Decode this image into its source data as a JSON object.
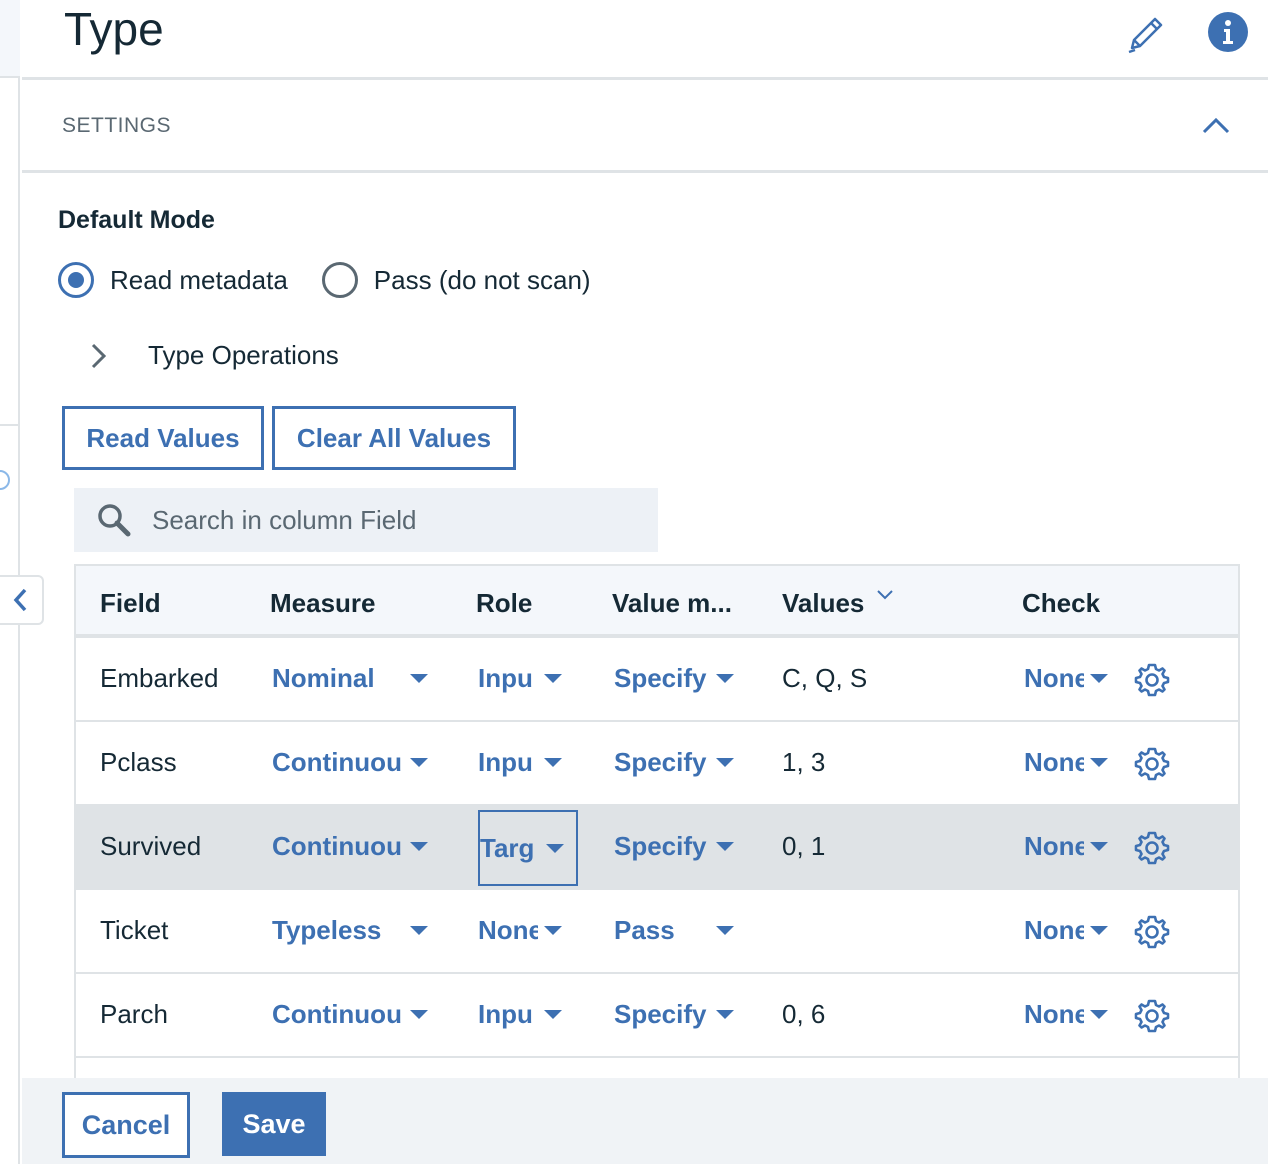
{
  "header": {
    "title": "Type"
  },
  "settings": {
    "label": "SETTINGS"
  },
  "default_mode": {
    "heading": "Default Mode",
    "options": [
      {
        "label": "Read metadata",
        "selected": true
      },
      {
        "label": "Pass (do not scan)",
        "selected": false
      }
    ]
  },
  "type_operations": {
    "label": "Type Operations"
  },
  "buttons": {
    "read_values": "Read Values",
    "clear_all_values": "Clear All Values"
  },
  "search": {
    "placeholder": "Search in column Field"
  },
  "table": {
    "columns": [
      "Field",
      "Measure",
      "Role",
      "Value m...",
      "Values",
      "Check"
    ],
    "rows": [
      {
        "field": "Embarked",
        "measure": "Nominal",
        "role": "Inpu",
        "value_mode": "Specify",
        "values": "C, Q, S",
        "check": "None",
        "selected": false
      },
      {
        "field": "Pclass",
        "measure": "Continuou",
        "role": "Inpu",
        "value_mode": "Specify",
        "values": "1, 3",
        "check": "None",
        "selected": false
      },
      {
        "field": "Survived",
        "measure": "Continuou",
        "role": "Targ",
        "value_mode": "Specify",
        "values": "0, 1",
        "check": "None",
        "selected": true
      },
      {
        "field": "Ticket",
        "measure": "Typeless",
        "role": "None",
        "value_mode": "Pass",
        "values": "",
        "check": "None",
        "selected": false
      },
      {
        "field": "Parch",
        "measure": "Continuou",
        "role": "Inpu",
        "value_mode": "Specify",
        "values": "0, 6",
        "check": "None",
        "selected": false
      }
    ]
  },
  "footer": {
    "cancel": "Cancel",
    "save": "Save"
  },
  "icons": {
    "edit": "pencil-icon",
    "info": "info-icon",
    "collapse": "chevron-up-icon",
    "expand": "chevron-right-icon",
    "search": "search-icon",
    "sort": "chevron-down-icon",
    "settings": "gear-icon",
    "side_toggle": "chevron-left-icon"
  },
  "colors": {
    "accent": "#3d70b2",
    "text": "#152935",
    "muted": "#5a6872",
    "border": "#dfe3e6",
    "selected_row": "#dfe3e6"
  }
}
